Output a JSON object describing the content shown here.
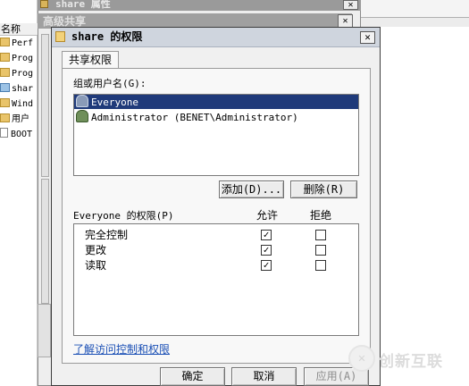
{
  "background": {
    "explorer": {
      "column_header": "名称",
      "items": [
        {
          "label": "Perf",
          "type": "folder"
        },
        {
          "label": "Prog",
          "type": "folder"
        },
        {
          "label": "Prog",
          "type": "folder"
        },
        {
          "label": "shar",
          "type": "shared-folder"
        },
        {
          "label": "Wind",
          "type": "folder"
        },
        {
          "label": "用户",
          "type": "folder"
        },
        {
          "label": "BOOT",
          "type": "file"
        }
      ]
    },
    "properties_window": {
      "title": "share 属性",
      "close_label": "✕"
    },
    "advanced_window": {
      "title": "高级共享",
      "close_label": "✕"
    }
  },
  "dialog": {
    "title": "share 的权限",
    "close_label": "✕",
    "tab_label": "共享权限",
    "users_label": "组或用户名(G):",
    "users": [
      {
        "name": "Everyone",
        "selected": true
      },
      {
        "name": "Administrator (BENET\\Administrator)",
        "selected": false
      }
    ],
    "add_button": "添加(D)...",
    "remove_button": "删除(R)",
    "permissions_label": "Everyone 的权限(P)",
    "allow_header": "允许",
    "deny_header": "拒绝",
    "permissions": [
      {
        "name": "完全控制",
        "allow": true,
        "deny": false
      },
      {
        "name": "更改",
        "allow": true,
        "deny": false
      },
      {
        "name": "读取",
        "allow": true,
        "deny": false
      }
    ],
    "learn_link": "了解访问控制和权限",
    "ok_button": "确定",
    "cancel_button": "取消",
    "apply_button": "应用(A)"
  },
  "watermark": {
    "logo_text": "✕",
    "text": "创新互联"
  },
  "colors": {
    "selection": "#1f3a7a",
    "link": "#1a4fb5"
  }
}
